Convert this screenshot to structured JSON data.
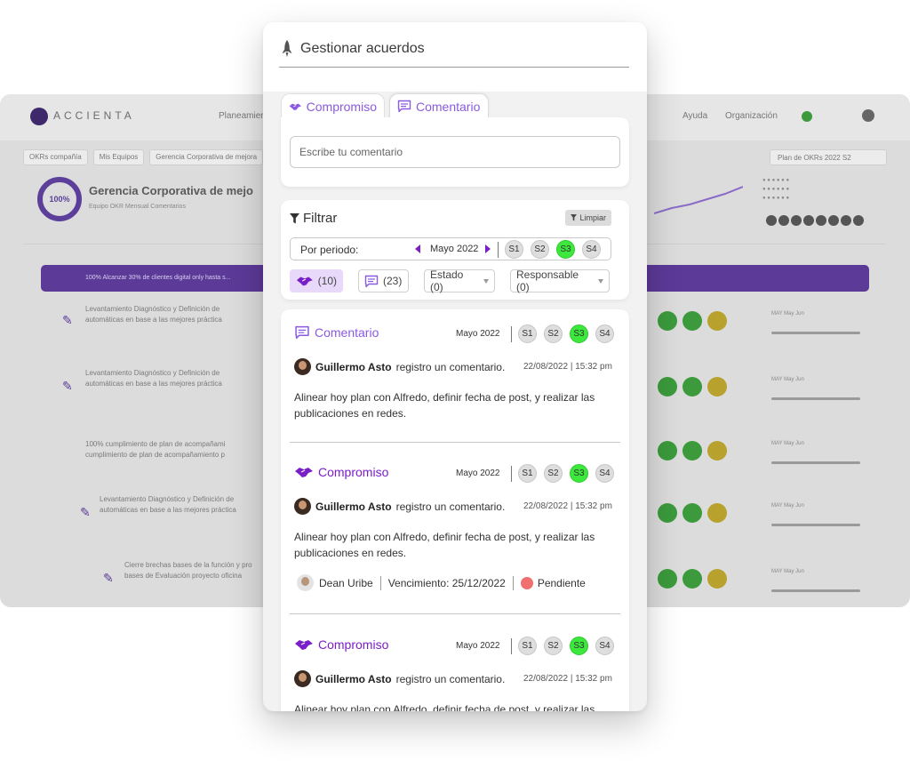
{
  "background_app": {
    "logo_text": "ACCIENTA",
    "nav_items": [
      "Planeamiento",
      "Ayuda",
      "Organización"
    ],
    "breadcrumbs": [
      "OKRs compañía",
      "Mis Equipos",
      "Gerencia Corporativa de mejora"
    ],
    "plan_select": "Plan de OKRs 2022 S2",
    "progress_value": "100%",
    "area_title": "Gerencia Corporativa de mejo",
    "area_tags": "Equipo OKR   Mensual   Comentarios",
    "banner_text": "100% Alcanzar 30% de clientes digital only hasta s...",
    "status_colors": {
      "green": "#3c9a3c",
      "yellow": "#b8a12c",
      "purple": "#5c3a98"
    },
    "rows": [
      {
        "line1": "Levantamiento Diagnóstico y Definición de",
        "line2": "automáticas en base a las mejores práctica"
      },
      {
        "line1": "Levantamiento Diagnóstico y Definición de",
        "line2": "automáticas en base a las mejores práctica"
      },
      {
        "line1": "100% cumplimiento de plan de acompañami",
        "line2": "cumplimiento de plan de acompañamiento p"
      },
      {
        "line1": "Levantamiento Diagnóstico y Definición de",
        "line2": "automáticas en base a las mejores práctica"
      },
      {
        "line1": "Cierre brechas bases de la función y pro",
        "line2": "bases de Evaluación proyecto oficina"
      }
    ],
    "mini_months": "MAY   May   Jun"
  },
  "panel": {
    "title": "Gestionar acuerdos",
    "title_icon": "rocket-icon",
    "tabs": [
      {
        "label": "Compromiso",
        "icon": "handshake-icon"
      },
      {
        "label": "Comentario",
        "icon": "comment-icon"
      }
    ],
    "comment": {
      "placeholder": "Escribe tu comentario",
      "value": ""
    },
    "filter": {
      "title": "Filtrar",
      "clear_label": "Limpiar",
      "period_label": "Por periodo:",
      "period_value": "Mayo 2022",
      "weeks": [
        "S1",
        "S2",
        "S3",
        "S4"
      ],
      "active_week": "S3",
      "chips": {
        "compromiso_count": "(10)",
        "comentario_count": "(23)",
        "estado_label": "Estado (0)",
        "responsable_label": "Responsable (0)"
      }
    },
    "items": [
      {
        "type": "Comentario",
        "month": "Mayo 2022",
        "weeks": [
          "S1",
          "S2",
          "S3",
          "S4"
        ],
        "user": "Guillermo Asto",
        "action": "registro un comentario.",
        "date": "22/08/2022 | 15:32 pm",
        "text": "Alinear hoy plan con Alfredo, definir fecha de post, y realizar las publicaciones en redes."
      },
      {
        "type": "Compromiso",
        "month": "Mayo 2022",
        "weeks": [
          "S1",
          "S2",
          "S3",
          "S4"
        ],
        "user": "Guillermo Asto",
        "action": "registro un comentario.",
        "date": "22/08/2022 | 15:32 pm",
        "text": "Alinear hoy plan con Alfredo, definir fecha de post, y realizar las publicaciones en redes.",
        "responsible": "Dean Uribe",
        "due": "Vencimiento: 25/12/2022",
        "status": "Pendiente",
        "status_color": "#f07070"
      },
      {
        "type": "Compromiso",
        "month": "Mayo 2022",
        "weeks": [
          "S1",
          "S2",
          "S3",
          "S4"
        ],
        "user": "Guillermo Asto",
        "action": "registro un comentario.",
        "date": "22/08/2022 | 15:32 pm",
        "text": "Alinear hoy plan con Alfredo, definir fecha de post, y realizar las publicaciones en redes."
      }
    ],
    "colors": {
      "accent": "#8a5ae0",
      "compromiso": "#7a1ec8",
      "active_week": "#3be83b"
    }
  }
}
